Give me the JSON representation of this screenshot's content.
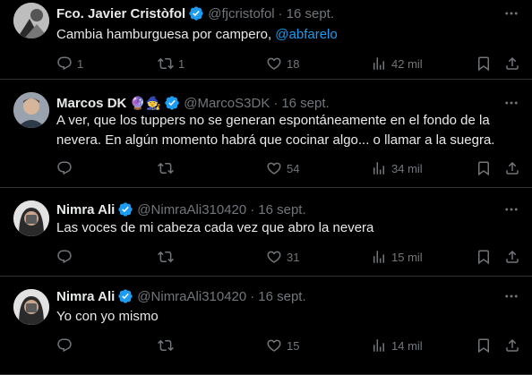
{
  "tweets": [
    {
      "name": "Fco. Javier Cristòfol",
      "emoji": "",
      "handle": "@fjcristofol",
      "date": "16 sept.",
      "text_lines": [
        "Cambia hamburguesa por campero, "
      ],
      "mention": "@abfarelo",
      "replies": "1",
      "retweets": "1",
      "likes": "18",
      "views": "42 mil",
      "avatar": "bw-photo"
    },
    {
      "name": "Marcos DK",
      "emoji": "🔮🧙",
      "handle": "@MarcoS3DK",
      "date": "16 sept.",
      "text_lines": [
        "A ver, que los tuppers no se generan espontáneamente en el fondo de la",
        "nevera. En algún momento habrá que cocinar algo... o llamar a la suegra."
      ],
      "mention": "",
      "replies": "",
      "retweets": "",
      "likes": "54",
      "views": "34 mil",
      "avatar": "man-photo"
    },
    {
      "name": "Nimra Ali",
      "emoji": "",
      "handle": "@NimraAli310420",
      "date": "16 sept.",
      "text_lines": [
        "Las voces de mi cabeza cada vez que abro la nevera"
      ],
      "mention": "",
      "replies": "",
      "retweets": "",
      "likes": "31",
      "views": "15 mil",
      "avatar": "girl-photo"
    },
    {
      "name": "Nimra Ali",
      "emoji": "",
      "handle": "@NimraAli310420",
      "date": "16 sept.",
      "text_lines": [
        "Yo con yo mismo"
      ],
      "mention": "",
      "replies": "",
      "retweets": "",
      "likes": "15",
      "views": "14 mil",
      "avatar": "girl-photo"
    }
  ],
  "colors": {
    "background": "#000000",
    "text": "#e7e9ea",
    "muted": "#71767b",
    "accent": "#1d9bf0",
    "divider": "#2f3336"
  },
  "icons": [
    "reply-icon",
    "retweet-icon",
    "like-icon",
    "views-icon",
    "bookmark-icon",
    "share-icon",
    "verified-badge-icon",
    "more-options-icon"
  ]
}
